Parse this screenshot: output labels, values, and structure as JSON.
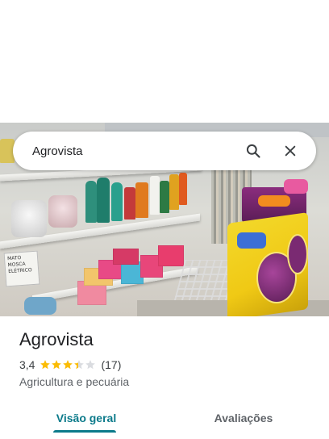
{
  "search": {
    "query": "Agrovista"
  },
  "photo": {
    "sign_text": "MATO MOSCA ELÉTRICO"
  },
  "place": {
    "name": "Agrovista",
    "rating": "3,4",
    "rating_value": 3.4,
    "review_count": "(17)",
    "category": "Agricultura e pecuária"
  },
  "tabs": [
    {
      "label": "Visão geral",
      "selected": true
    },
    {
      "label": "Avaliações",
      "selected": false
    }
  ],
  "colors": {
    "accent": "#0b7a8a",
    "star_filled": "#fbbc04",
    "star_empty": "#dadce0"
  },
  "icons": [
    "search-icon",
    "close-icon",
    "star-icon"
  ]
}
